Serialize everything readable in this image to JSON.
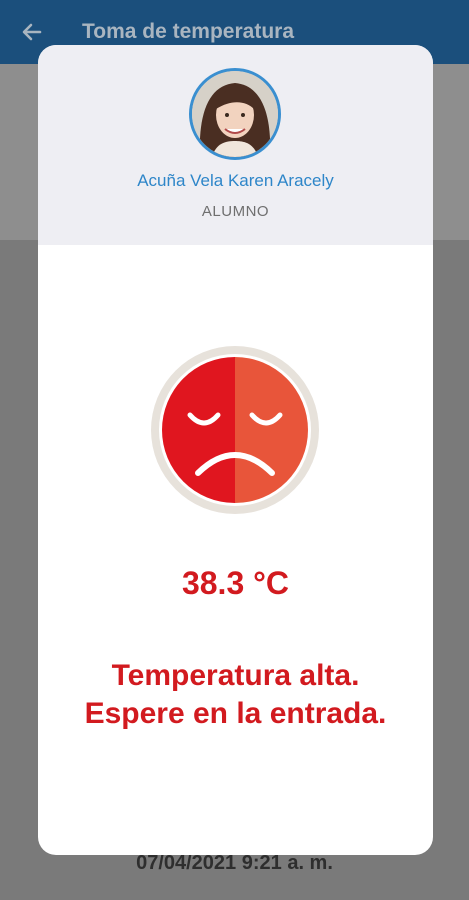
{
  "appbar": {
    "title": "Toma de temperatura",
    "back_icon": "arrow-left-icon"
  },
  "student": {
    "name": "Acuña Vela Karen Aracely",
    "role": "ALUMNO"
  },
  "reading": {
    "temperature": "38.3 °C",
    "status_icon": "sad-face-icon",
    "message_line1": "Temperatura alta.",
    "message_line2": "Espere en la entrada."
  },
  "footer": {
    "date": "07/04/2021 9:21 a. m."
  },
  "colors": {
    "appbar": "#1b4f7c",
    "alert_red": "#d21a1f",
    "face_left": "#e0161f",
    "face_right": "#e8553a",
    "name_blue": "#2e86c9"
  }
}
